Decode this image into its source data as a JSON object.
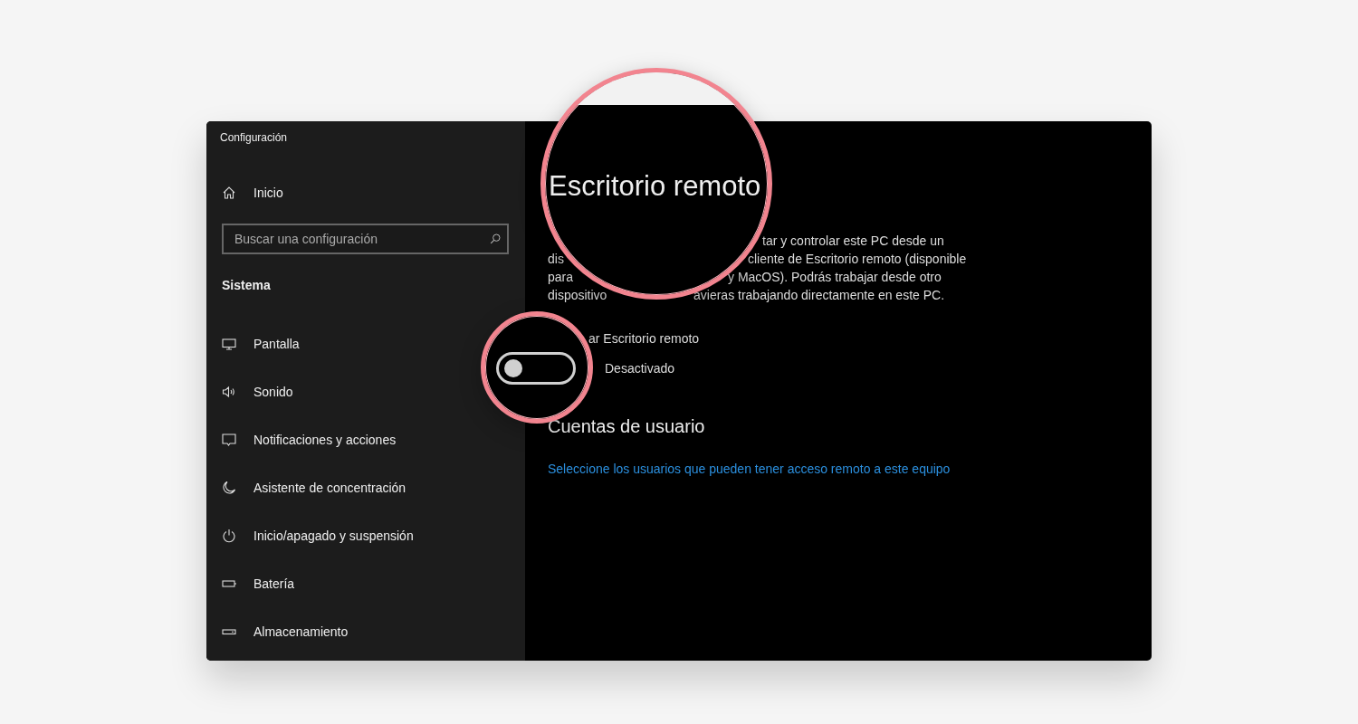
{
  "window": {
    "title": "Configuración"
  },
  "sidebar": {
    "home": "Inicio",
    "search": {
      "placeholder": "Buscar una configuración"
    },
    "section": "Sistema",
    "items": [
      {
        "label": "Pantalla"
      },
      {
        "label": "Sonido"
      },
      {
        "label": "Notificaciones y acciones"
      },
      {
        "label": "Asistente de concentración"
      },
      {
        "label": "Inicio/apagado y suspensión"
      },
      {
        "label": "Batería"
      },
      {
        "label": "Almacenamiento"
      }
    ]
  },
  "content": {
    "title": "Escritorio remoto",
    "description_lines": [
      {
        "right": "tar y controlar este PC desde un"
      },
      {
        "left": "dis",
        "right": "cliente de Escritorio remoto (disponible"
      },
      {
        "left": "para",
        "right": "y MacOS). Podrás trabajar desde otro"
      },
      {
        "left": "dispositivo",
        "right": "avieras trabajando directamente en este PC."
      }
    ],
    "toggle_label": "ar Escritorio remoto",
    "toggle": {
      "on": false,
      "state_label": "Desactivado"
    },
    "section_heading": "Cuentas de usuario",
    "link": "Seleccione los usuarios que pueden tener acceso remoto a este equipo"
  }
}
